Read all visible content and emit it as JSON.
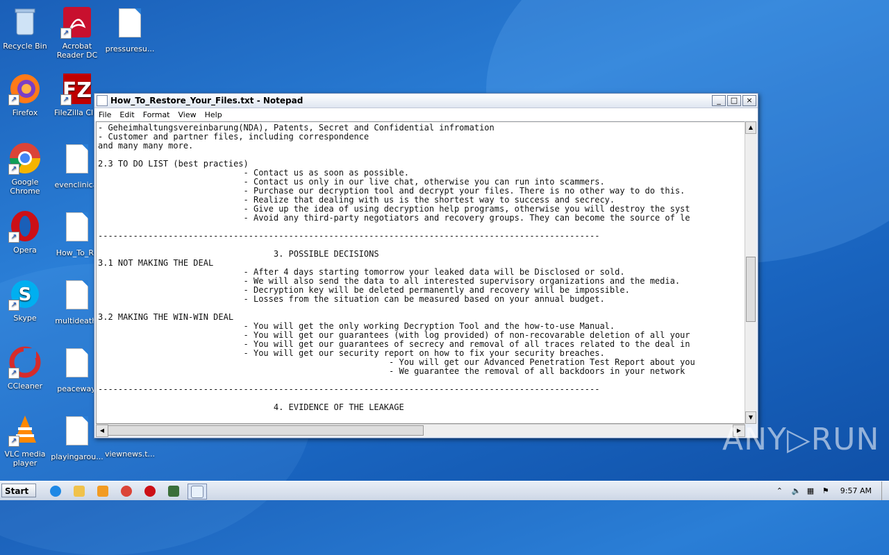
{
  "desktop": {
    "icons": [
      {
        "label": "Recycle Bin"
      },
      {
        "label": "Acrobat Reader DC"
      },
      {
        "label": "pressuresu..."
      },
      {
        "label": "Firefox"
      },
      {
        "label": "FileZilla Clie"
      },
      {
        "label": "Google Chrome"
      },
      {
        "label": "evenclinical"
      },
      {
        "label": "Opera"
      },
      {
        "label": "How_To_Re"
      },
      {
        "label": "Skype"
      },
      {
        "label": "multideath."
      },
      {
        "label": "CCleaner"
      },
      {
        "label": "peaceway."
      },
      {
        "label": "VLC media player"
      },
      {
        "label": "playingarou..."
      },
      {
        "label": "viewnews.t..."
      }
    ]
  },
  "window": {
    "title": "How_To_Restore_Your_Files.txt - Notepad",
    "menu": [
      "File",
      "Edit",
      "Format",
      "View",
      "Help"
    ],
    "buttons": {
      "minimize": "_",
      "maximize": "□",
      "close": "×"
    },
    "text": "- Geheimhaltungsvereinbarung(NDA), Patents, Secret and Confidential infromation\n- Customer and partner files, including correspondence\nand many many more.\n\n2.3 TO DO LIST (best practies)\n                             - Contact us as soon as possible.\n                             - Contact us only in our live chat, otherwise you can run into scammers.\n                             - Purchase our decryption tool and decrypt your files. There is no other way to do this.\n                             - Realize that dealing with us is the shortest way to success and secrecy.\n                             - Give up the idea of using decryption help programs, otherwise you will destroy the syst\n                             - Avoid any third-party negotiators and recovery groups. They can become the source of le\n\n----------------------------------------------------------------------------------------------------\n\n                                   3. POSSIBLE DECISIONS\n3.1 NOT MAKING THE DEAL\n                             - After 4 days starting tomorrow your leaked data will be Disclosed or sold.\n                             - We will also send the data to all interested supervisory organizations and the media.\n                             - Decryption key will be deleted permanently and recovery will be impossible.\n                             - Losses from the situation can be measured based on your annual budget.\n\n3.2 MAKING THE WIN-WIN DEAL\n                             - You will get the only working Decryption Tool and the how-to-use Manual.\n                             - You will get our guarantees (with log provided) of non-recovarable deletion of all your\n                             - You will get our guarantees of secrecy and removal of all traces related to the deal in\n                             - You will get our security report on how to fix your security breaches.\n                                                          - You will get our Advanced Penetration Test Report about you\n                                                          - We guarantee the removal of all backdoors in your network\n\n----------------------------------------------------------------------------------------------------\n\n                                   4. EVIDENCE OF THE LEAKAGE"
  },
  "taskbar": {
    "start_label": "Start",
    "clock": "9:57 AM"
  },
  "watermark": "ANY▷RUN"
}
